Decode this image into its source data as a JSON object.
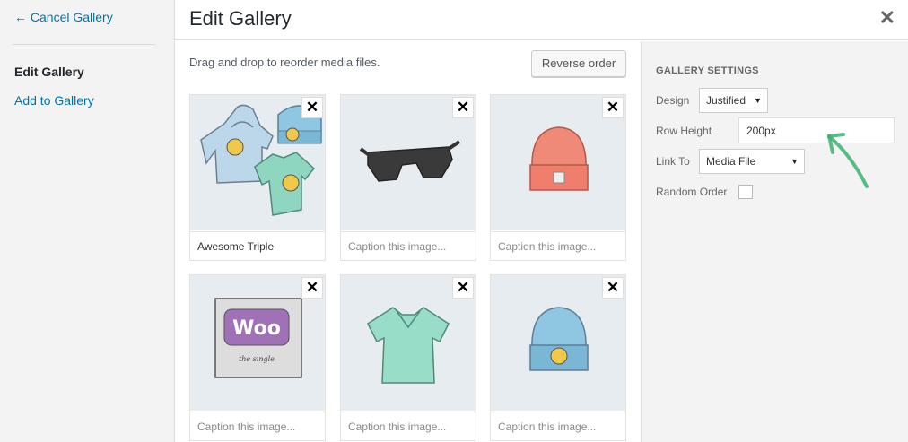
{
  "menu": {
    "cancel_label": "← Cancel Gallery",
    "edit_label": "Edit Gallery",
    "add_label": "Add to Gallery"
  },
  "header": {
    "title": "Edit Gallery",
    "close_glyph": "✕"
  },
  "content": {
    "instructions": "Drag and drop to reorder media files.",
    "reverse_label": "Reverse order",
    "items": [
      {
        "image": "hoodie-beanie-tshirt-image",
        "caption": "Awesome Triple",
        "placeholder": "Caption this image..."
      },
      {
        "image": "sunglasses-image",
        "caption": "",
        "placeholder": "Caption this image..."
      },
      {
        "image": "orange-beanie-image",
        "caption": "",
        "placeholder": "Caption this image..."
      },
      {
        "image": "woo-album-image",
        "caption": "",
        "placeholder": "Caption this image..."
      },
      {
        "image": "green-tshirt-image",
        "caption": "",
        "placeholder": "Caption this image..."
      },
      {
        "image": "blue-beanie-image",
        "caption": "",
        "placeholder": "Caption this image..."
      }
    ],
    "remove_glyph": "✕"
  },
  "settings": {
    "heading": "GALLERY SETTINGS",
    "design_label": "Design",
    "design_value": "Justified",
    "row_height_label": "Row Height",
    "row_height_value": "200px",
    "link_to_label": "Link To",
    "link_to_value": "Media File",
    "random_order_label": "Random Order",
    "random_order_checked": false
  },
  "colors": {
    "link": "#0073aa",
    "annotation_arrow": "#3cb371"
  }
}
